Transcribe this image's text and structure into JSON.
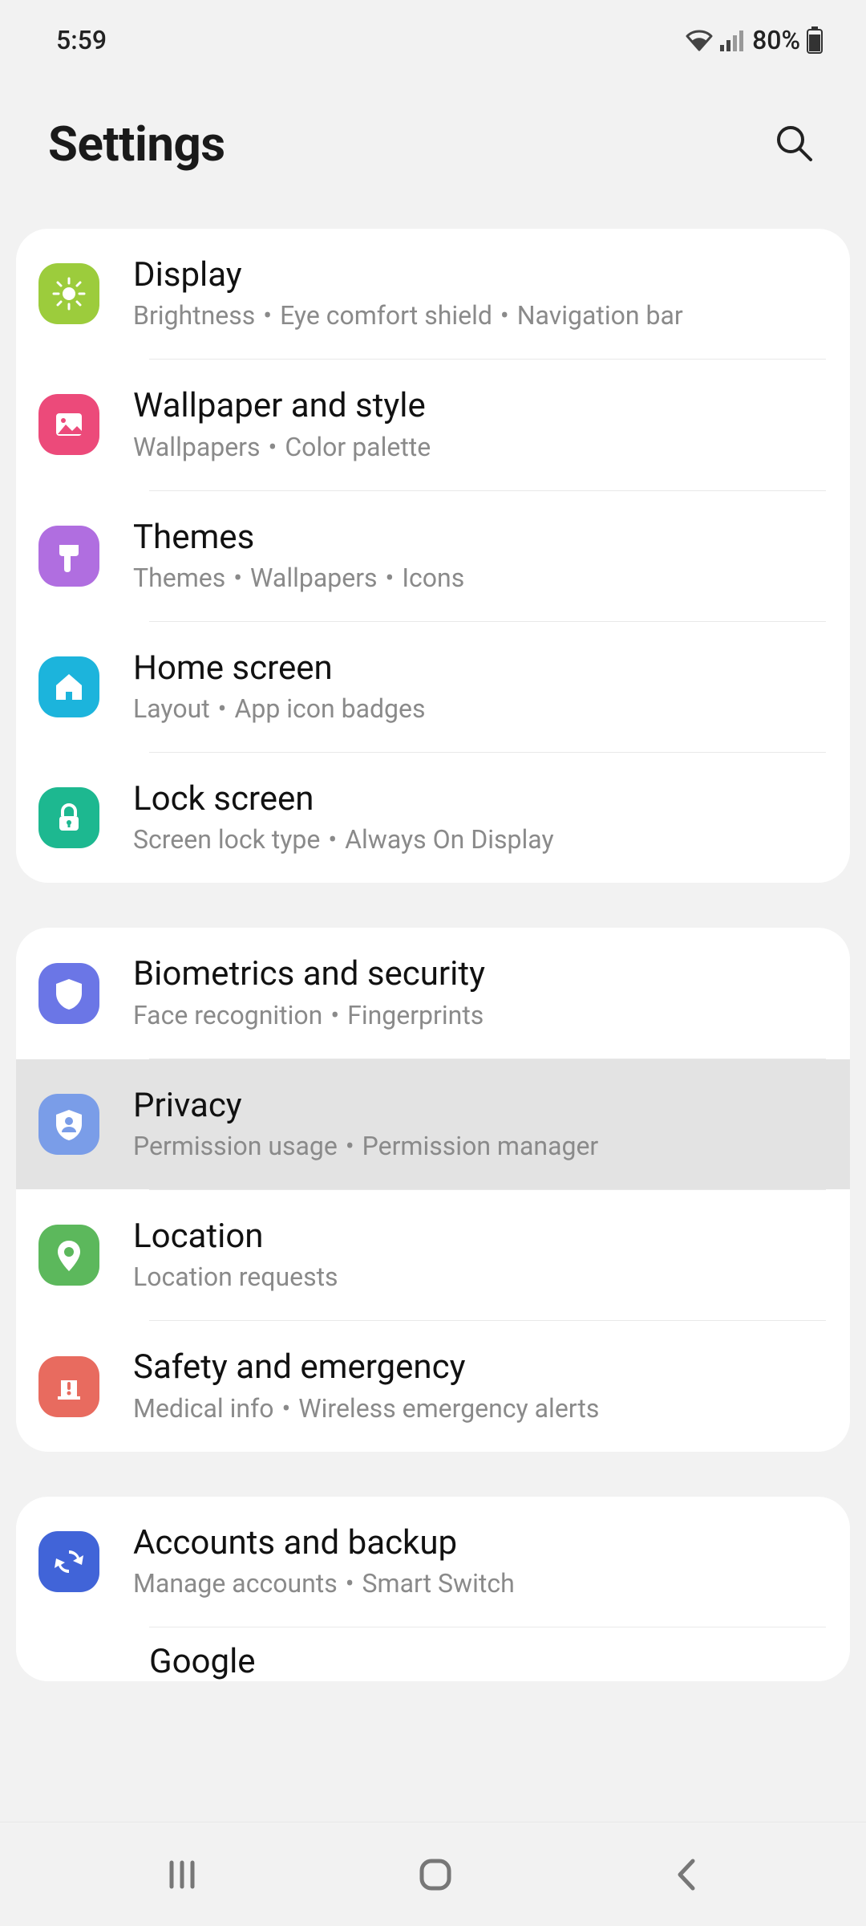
{
  "status": {
    "time": "5:59",
    "battery": "80%"
  },
  "header": {
    "title": "Settings"
  },
  "groups": [
    {
      "items": [
        {
          "id": "display",
          "title": "Display",
          "subs": [
            "Brightness",
            "Eye comfort shield",
            "Navigation bar"
          ],
          "color": "#9ccc3c",
          "icon": "sun"
        },
        {
          "id": "wallpaper",
          "title": "Wallpaper and style",
          "subs": [
            "Wallpapers",
            "Color palette"
          ],
          "color": "#ec4a7a",
          "icon": "picture"
        },
        {
          "id": "themes",
          "title": "Themes",
          "subs": [
            "Themes",
            "Wallpapers",
            "Icons"
          ],
          "color": "#b06ee0",
          "icon": "brush"
        },
        {
          "id": "home",
          "title": "Home screen",
          "subs": [
            "Layout",
            "App icon badges"
          ],
          "color": "#1cb4dc",
          "icon": "home"
        },
        {
          "id": "lock",
          "title": "Lock screen",
          "subs": [
            "Screen lock type",
            "Always On Display"
          ],
          "color": "#1db890",
          "icon": "lock"
        }
      ]
    },
    {
      "items": [
        {
          "id": "biometrics",
          "title": "Biometrics and security",
          "subs": [
            "Face recognition",
            "Fingerprints"
          ],
          "color": "#6b76e6",
          "icon": "shield"
        },
        {
          "id": "privacy",
          "title": "Privacy",
          "subs": [
            "Permission usage",
            "Permission manager"
          ],
          "color": "#7a9de8",
          "icon": "shield-person",
          "highlight": true
        },
        {
          "id": "location",
          "title": "Location",
          "subs": [
            "Location requests"
          ],
          "color": "#5cb85c",
          "icon": "pin"
        },
        {
          "id": "safety",
          "title": "Safety and emergency",
          "subs": [
            "Medical info",
            "Wireless emergency alerts"
          ],
          "color": "#e86b5f",
          "icon": "alert"
        }
      ]
    },
    {
      "items": [
        {
          "id": "accounts",
          "title": "Accounts and backup",
          "subs": [
            "Manage accounts",
            "Smart Switch"
          ],
          "color": "#4164d8",
          "icon": "sync"
        }
      ],
      "partial": "Google"
    }
  ]
}
